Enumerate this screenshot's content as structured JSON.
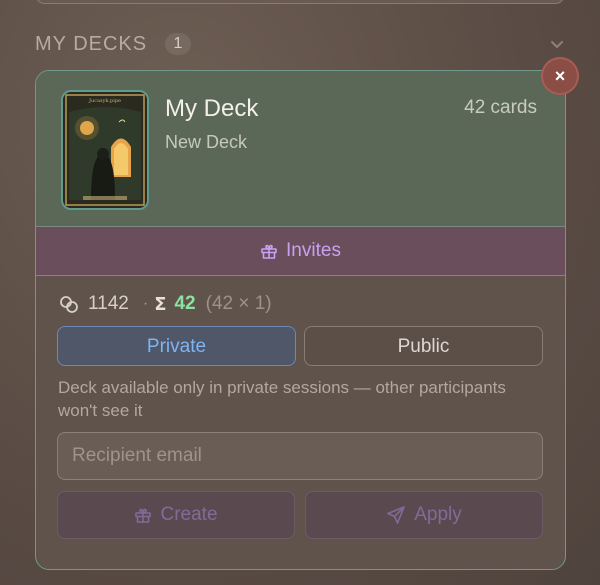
{
  "section": {
    "title": "MY DECKS",
    "count": "1",
    "collapse_icon": "chevron-down-icon"
  },
  "deck": {
    "title": "My Deck",
    "subtitle": "New Deck",
    "card_count": "42 cards",
    "thumbnail_caption": "Jucasyk.pipe"
  },
  "invites": {
    "label": "Invites",
    "icon": "gift-icon"
  },
  "stats": {
    "users_icon": "users-icon",
    "users": "1142",
    "separator": "·",
    "sigma": "Σ",
    "total": "42",
    "detail": "(42 × 1)"
  },
  "visibility": {
    "selected": "Private",
    "private_label": "Private",
    "public_label": "Public",
    "description": "Deck available only in private sessions — other participants won't see it"
  },
  "email": {
    "placeholder": "Recipient email",
    "value": ""
  },
  "actions": {
    "create_label": "Create",
    "create_icon": "gift-icon",
    "apply_label": "Apply",
    "apply_icon": "send-icon"
  },
  "close": {
    "symbol": "×",
    "icon": "close-icon"
  },
  "colors": {
    "accent_green": "#8fe1a1",
    "private_blue": "#7fb3f2",
    "invites_purple": "#c9a1f2",
    "card_border": "#6f9988",
    "close_red": "#8a4e47"
  }
}
